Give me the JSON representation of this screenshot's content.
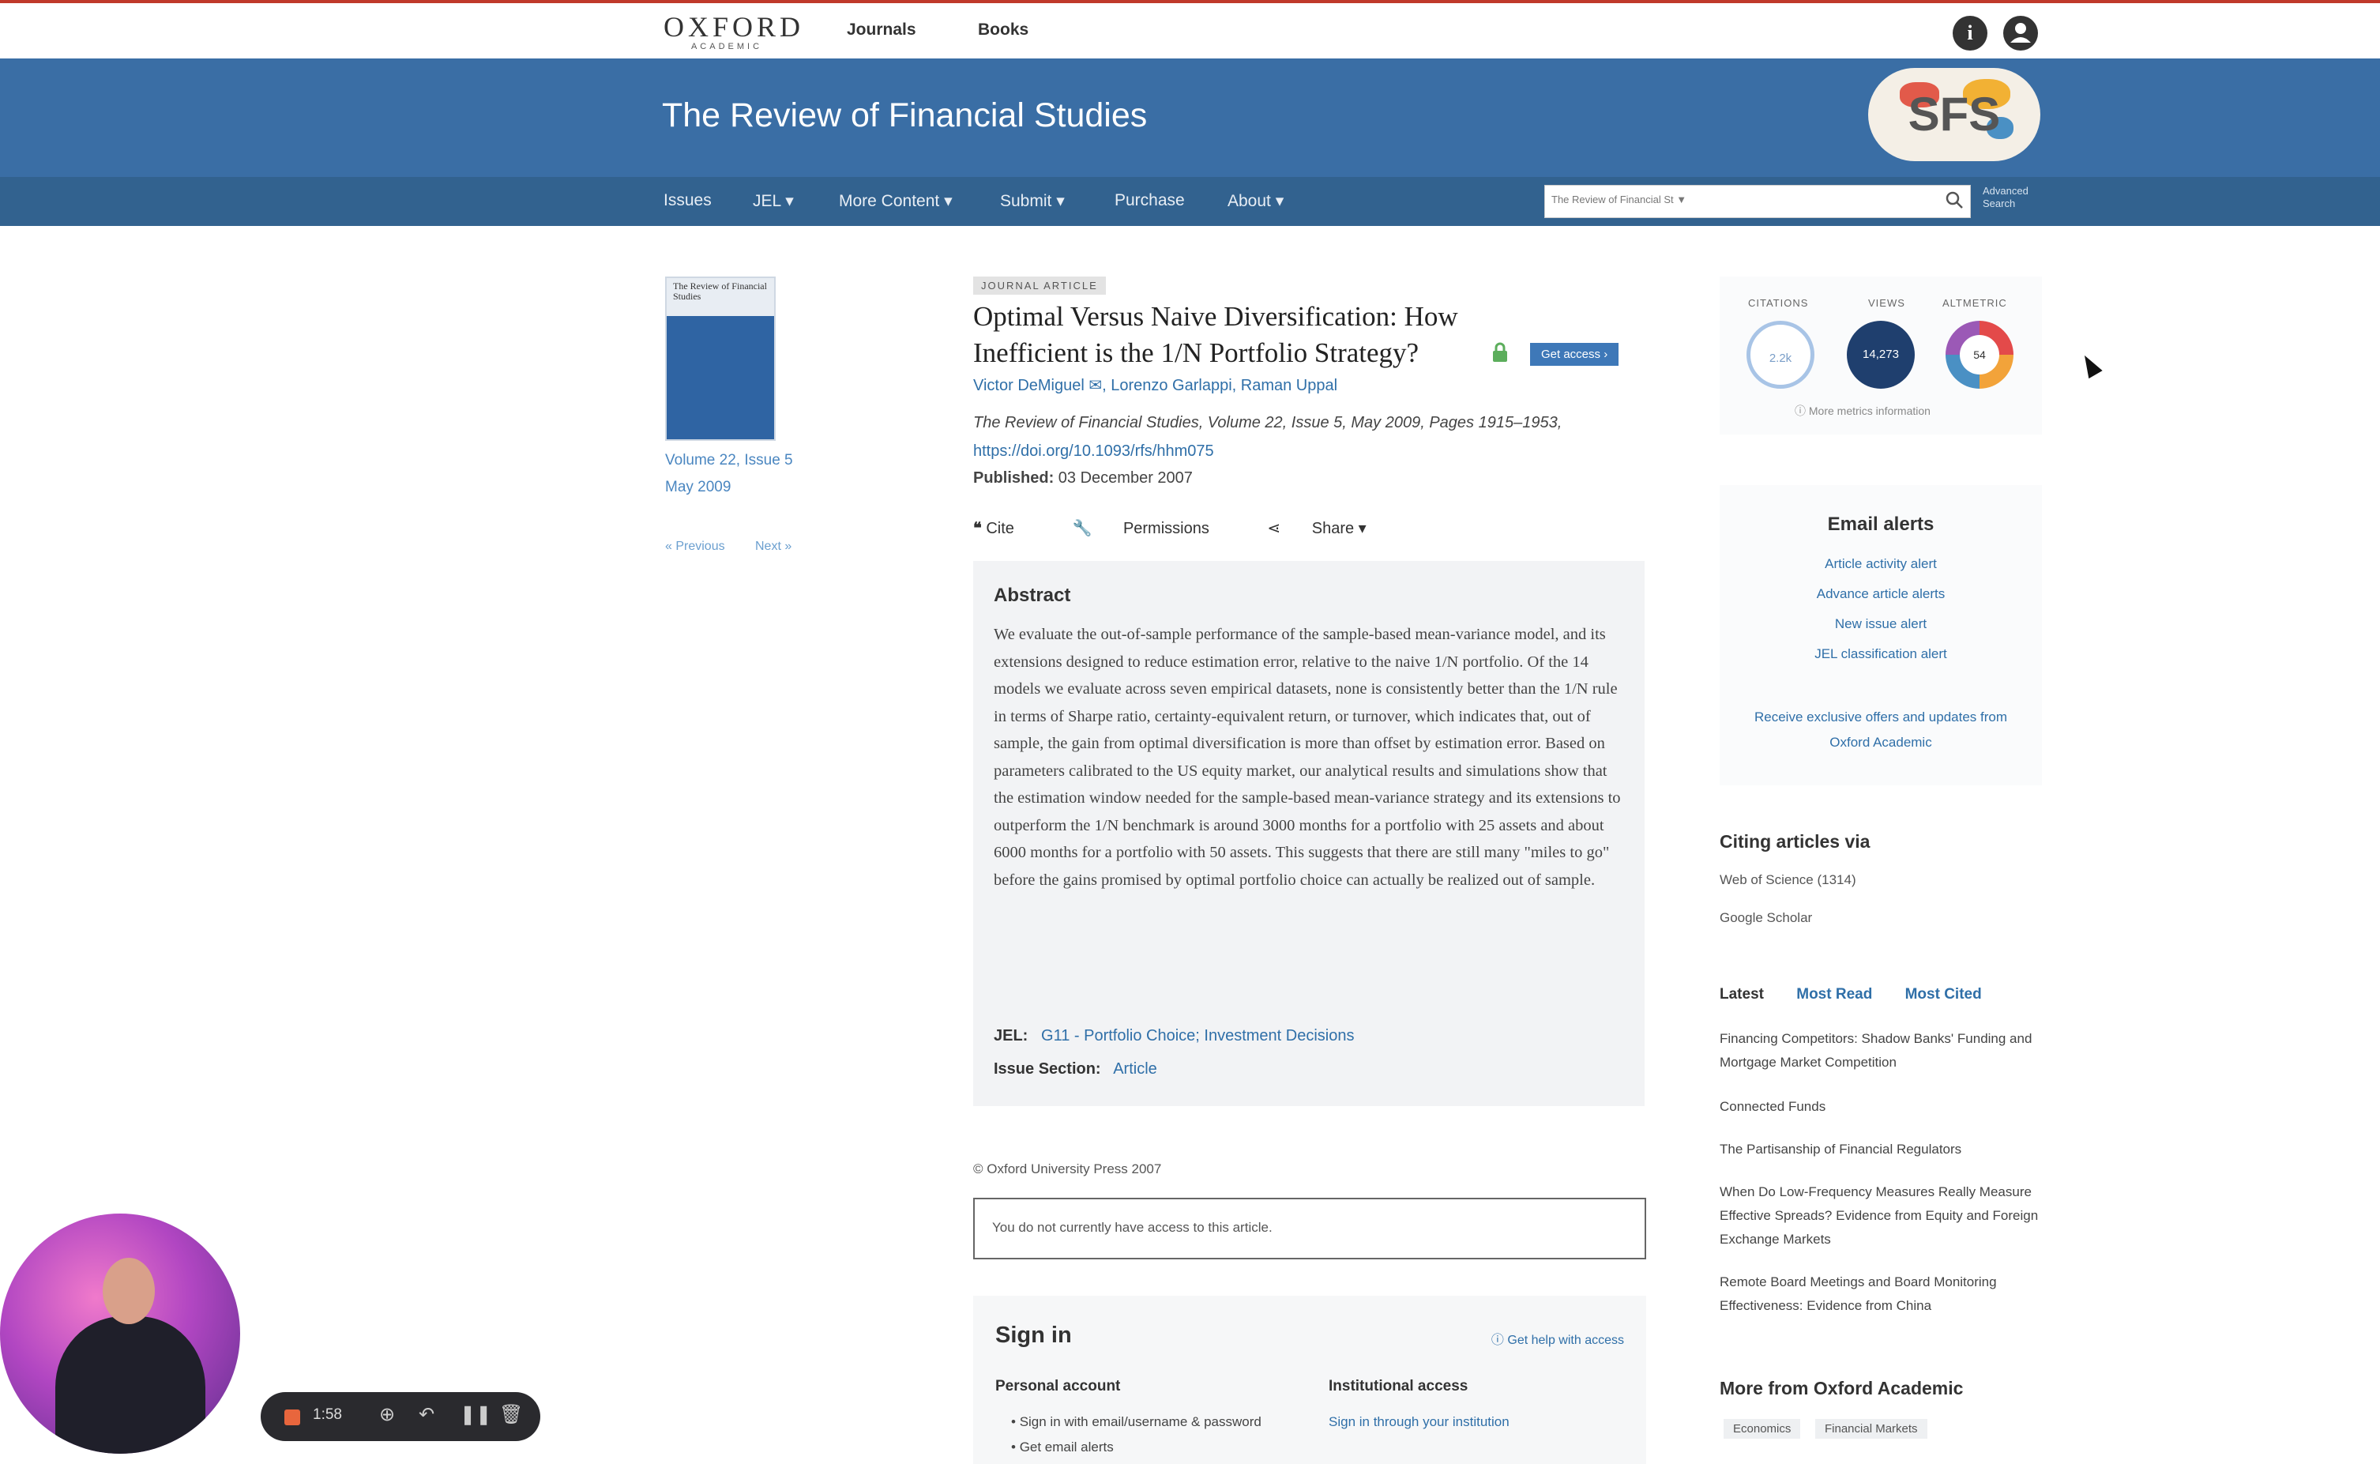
{
  "topbar": {
    "logo_line1": "OXFORD",
    "logo_line2": "ACADEMIC",
    "nav": [
      "Journals",
      "Books"
    ],
    "info_icon": "info-icon",
    "account_icon": "account-icon"
  },
  "journal": {
    "title": "The Review of Financial Studies",
    "logo_text": "SFS"
  },
  "subnav": {
    "items": [
      "Issues",
      "JEL ▾",
      "More Content ▾",
      "Submit ▾",
      "Purchase",
      "About ▾"
    ],
    "search_scope": "The Review of Financial St",
    "advanced_search": "Advanced Search"
  },
  "left": {
    "cover_text": "The Review of Financial Studies",
    "issue_line1": "Volume 22, Issue 5",
    "issue_line2": "May 2009",
    "previous": "« Previous",
    "next": "Next »"
  },
  "article": {
    "badge": "JOURNAL ARTICLE",
    "title_line1": "Optimal Versus Naive Diversification: How",
    "title_line2": "Inefficient is the 1/N Portfolio Strategy?",
    "get_access": "Get access ›",
    "authors": "Victor DeMiguel ✉, Lorenzo Garlappi, Raman Uppal",
    "citation": "The Review of Financial Studies, Volume 22, Issue 5, May 2009, Pages 1915–1953,",
    "doi": "https://doi.org/10.1093/rfs/hhm075",
    "published_label": "Published:",
    "published_date": "03 December 2007",
    "actions": [
      "Cite",
      "Permissions",
      "Share ▾"
    ]
  },
  "abstract": {
    "heading": "Abstract",
    "text": "We evaluate the out-of-sample performance of the sample-based mean-variance model, and its extensions designed to reduce estimation error, relative to the naive 1/N portfolio. Of the 14 models we evaluate across seven empirical datasets, none is consistently better than the 1/N rule in terms of Sharpe ratio, certainty-equivalent return, or turnover, which indicates that, out of sample, the gain from optimal diversification is more than offset by estimation error. Based on parameters calibrated to the US equity market, our analytical results and simulations show that the estimation window needed for the sample-based mean-variance strategy and its extensions to outperform the 1/N benchmark is around 3000 months for a portfolio with 25 assets and about 6000 months for a portfolio with 50 assets. This suggests that there are still many \"miles to go\" before the gains promised by optimal portfolio choice can actually be realized out of sample.",
    "jel_label": "JEL:",
    "jel_value": "G11 - Portfolio Choice; Investment Decisions",
    "issue_section_label": "Issue Section:",
    "issue_section_value": "Article"
  },
  "access": {
    "copyright": "© Oxford University Press 2007",
    "no_access": "You do not currently have access to this article."
  },
  "signin": {
    "heading": "Sign in",
    "help": "Get help with access",
    "personal_account": "Personal account",
    "personal_items": [
      "Sign in with email/username & password",
      "Get email alerts"
    ],
    "institutional_access": "Institutional access",
    "institutional_items": [
      "Sign in through your institution"
    ]
  },
  "metrics": {
    "citations_label": "CITATIONS",
    "citations_value": "2.2k",
    "views_label": "VIEWS",
    "views_value": "14,273",
    "altmetric_label": "ALTMETRIC",
    "altmetric_value": "54",
    "more_info": "More metrics information"
  },
  "email_alerts": {
    "heading": "Email alerts",
    "links": [
      "Article activity alert",
      "Advance article alerts",
      "New issue alert",
      "JEL classification alert"
    ],
    "receive": "Receive exclusive offers and updates from Oxford Academic"
  },
  "citing": {
    "heading": "Citing articles via",
    "items": [
      "Web of Science (1314)",
      "Google Scholar"
    ]
  },
  "latest": {
    "tabs": [
      "Latest",
      "Most Read",
      "Most Cited"
    ],
    "items": [
      "Financing Competitors: Shadow Banks' Funding and Mortgage Market Competition",
      "Connected Funds",
      "The Partisanship of Financial Regulators",
      "When Do Low-Frequency Measures Really Measure Effective Spreads? Evidence from Equity and Foreign Exchange Markets",
      "Remote Board Meetings and Board Monitoring Effectiveness: Evidence from China"
    ]
  },
  "more_oxford": {
    "heading": "More from Oxford Academic",
    "chips": [
      "Economics",
      "Financial Markets"
    ]
  },
  "recorder": {
    "time": "1:58"
  },
  "colors": {
    "header_blue": "#3a6ea5",
    "subnav_blue": "#32628f",
    "link_blue": "#2f6fa8",
    "button_blue": "#3e78b8",
    "views_navy": "#1f3f6e"
  }
}
